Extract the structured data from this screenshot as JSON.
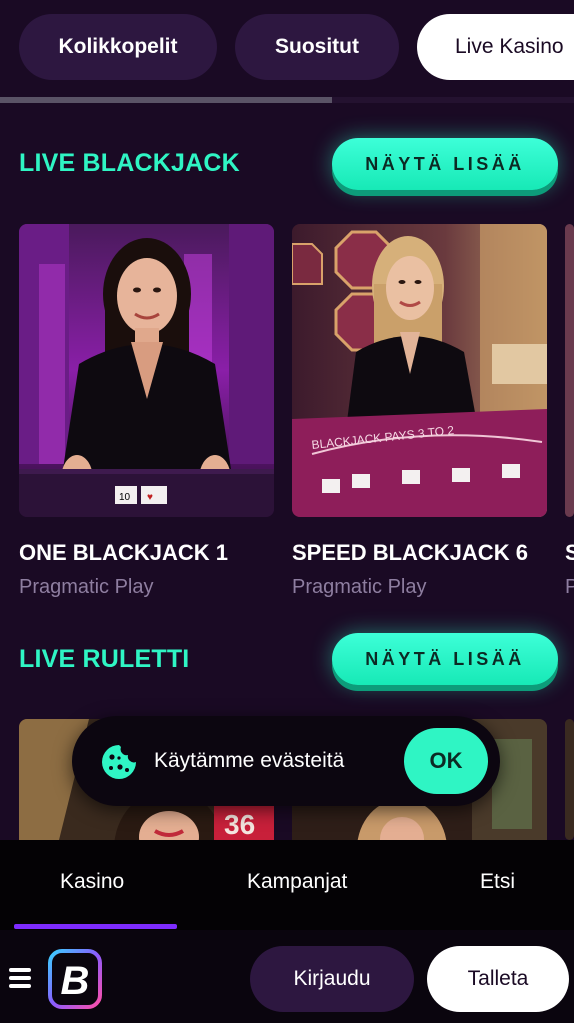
{
  "tabs": [
    {
      "label": "Kolikkopelit",
      "active": false
    },
    {
      "label": "Suositut",
      "active": false
    },
    {
      "label": "Live Kasino",
      "active": true
    }
  ],
  "sections": [
    {
      "title": "LIVE BLACKJACK",
      "more_label": "NÄYTÄ LISÄÄ",
      "games": [
        {
          "title": "ONE BLACKJACK 1",
          "provider": "Pragmatic Play"
        },
        {
          "title": "SPEED BLACKJACK 6",
          "provider": "Pragmatic Play"
        },
        {
          "title": "S",
          "provider": "P"
        }
      ]
    },
    {
      "title": "LIVE RULETTI",
      "more_label": "NÄYTÄ LISÄÄ",
      "thumb_number": "36"
    }
  ],
  "cookie": {
    "text": "Käytämme evästeitä",
    "ok_label": "OK"
  },
  "bottom_nav": {
    "items": [
      {
        "label": "Kasino",
        "active": true
      },
      {
        "label": "Kampanjat",
        "active": false
      },
      {
        "label": "Etsi",
        "active": false
      }
    ]
  },
  "footer": {
    "logo_letter": "B",
    "login_label": "Kirjaudu",
    "deposit_label": "Talleta"
  },
  "colors": {
    "background": "#1a0a24",
    "accent": "#2ff5c4",
    "nav_indicator": "#7e2cff",
    "pill": "#2d1740"
  }
}
